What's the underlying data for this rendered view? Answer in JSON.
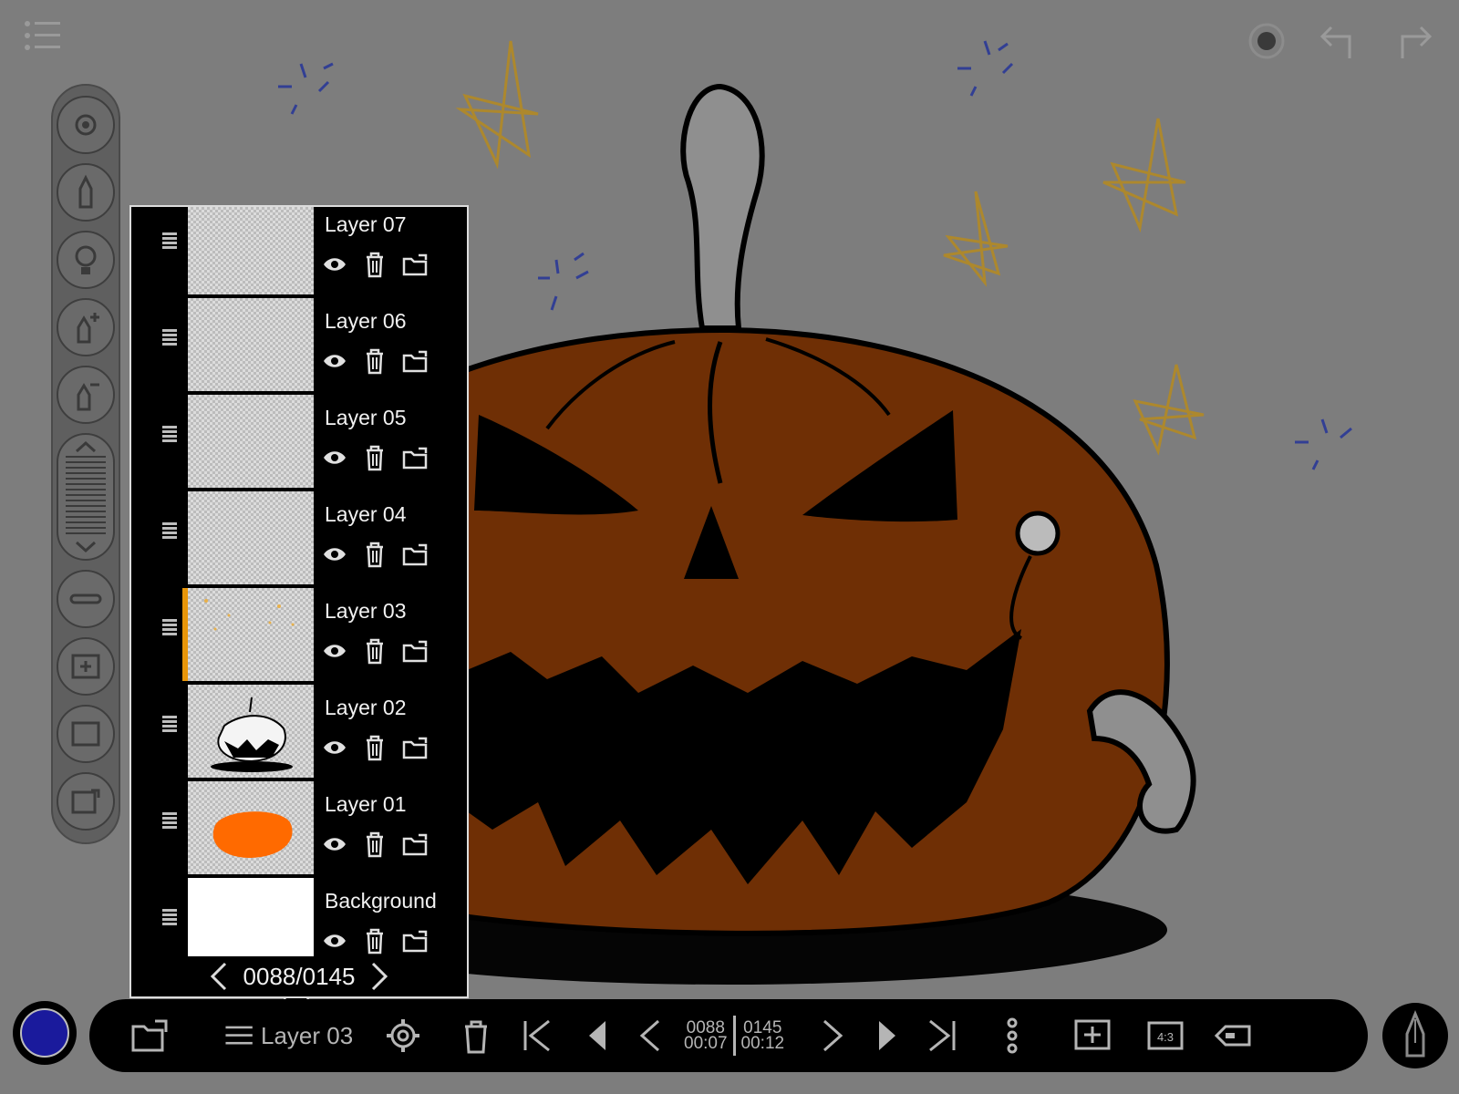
{
  "app": {
    "accent_color": "#e8960a",
    "panel_bg": "#000000",
    "canvas_bg": "#7d7d7d"
  },
  "top_left": {
    "menu_icon": "list-menu-icon"
  },
  "top_right": {
    "record_icon": "record-icon",
    "undo_icon": "undo-icon",
    "redo_icon": "redo-icon"
  },
  "tool_rail": {
    "tools": [
      "settings-gear-icon",
      "pen-tool-icon",
      "lightbulb-icon",
      "brush-plus-icon",
      "brush-minus-icon",
      "size-slider",
      "resize-handle-icon",
      "add-frame-icon",
      "frame-icon",
      "frame-export-icon"
    ]
  },
  "layers_panel": {
    "layers": [
      {
        "name": "Layer 07",
        "thumb": "empty",
        "active": false
      },
      {
        "name": "Layer 06",
        "thumb": "empty",
        "active": false
      },
      {
        "name": "Layer 05",
        "thumb": "empty",
        "active": false
      },
      {
        "name": "Layer 04",
        "thumb": "empty",
        "active": false
      },
      {
        "name": "Layer 03",
        "thumb": "dots",
        "active": true
      },
      {
        "name": "Layer 02",
        "thumb": "pumpkin-outline",
        "active": false
      },
      {
        "name": "Layer 01",
        "thumb": "pumpkin-fill",
        "active": false
      },
      {
        "name": "Background",
        "thumb": "white",
        "active": false
      }
    ],
    "layer_actions": [
      "eye-icon",
      "trash-icon",
      "folder-icon"
    ],
    "pager": {
      "count": "0088/0145"
    }
  },
  "bottom_bar": {
    "current_color": "#1a1a9c",
    "layer_select_label": "Layer 03",
    "frame_current": "0088",
    "time_current": "00:07",
    "frame_total": "0145",
    "time_total": "00:12",
    "icons": [
      "folder-open-icon",
      "menu-lines-icon",
      "gear-icon",
      "trash-icon",
      "first-frame-icon",
      "play-back-icon",
      "prev-frame-icon",
      "next-frame-icon",
      "play-icon",
      "last-frame-icon",
      "more-vertical-icon",
      "add-frame-icon",
      "aspect-ratio-icon",
      "tag-icon",
      "pen-nib-icon"
    ],
    "aspect_label": "4:3"
  }
}
